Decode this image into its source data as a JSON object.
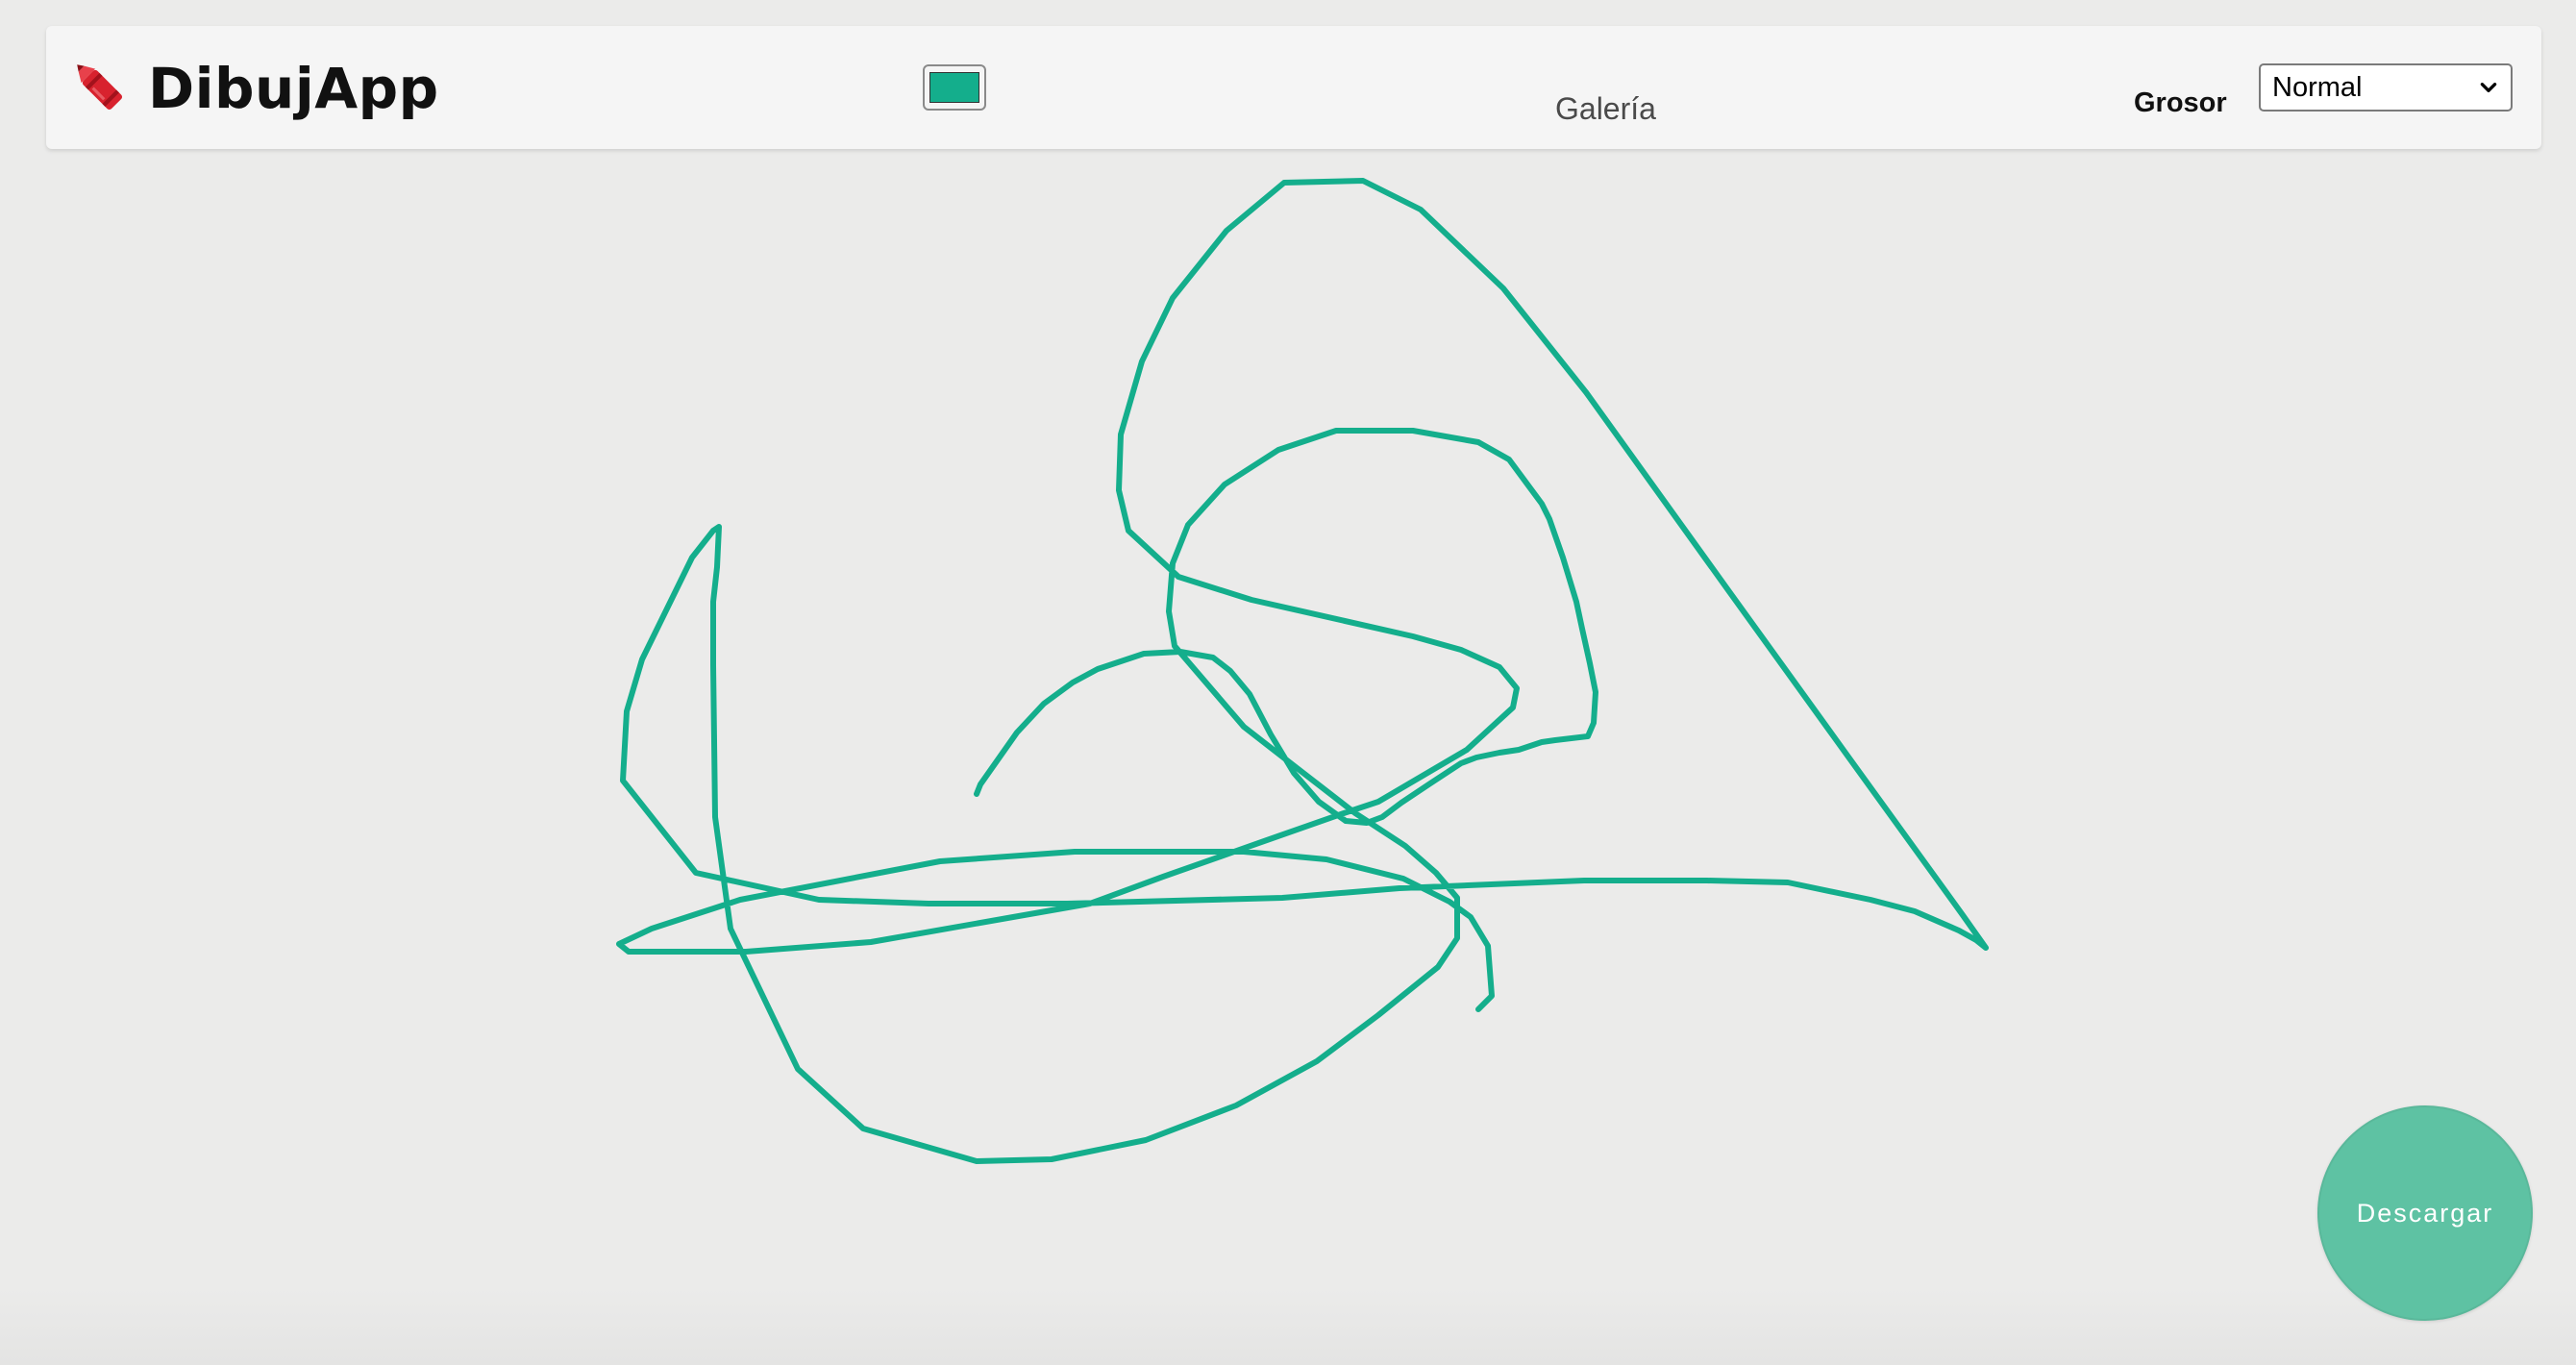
{
  "app": {
    "name": "DibujApp",
    "icon": "crayon-icon"
  },
  "toolbar": {
    "color_value": "#14ae8c",
    "gallery_label": "Galería",
    "thickness_label": "Grosor",
    "thickness_selected": "Normal"
  },
  "canvas": {
    "stroke_color": "#14ae8c"
  },
  "actions": {
    "download_label": "Descargar"
  },
  "colors": {
    "accent": "#14ae8c",
    "download_button": "#5ec2a3",
    "background": "#ebebea",
    "navbar": "#f5f5f5"
  }
}
